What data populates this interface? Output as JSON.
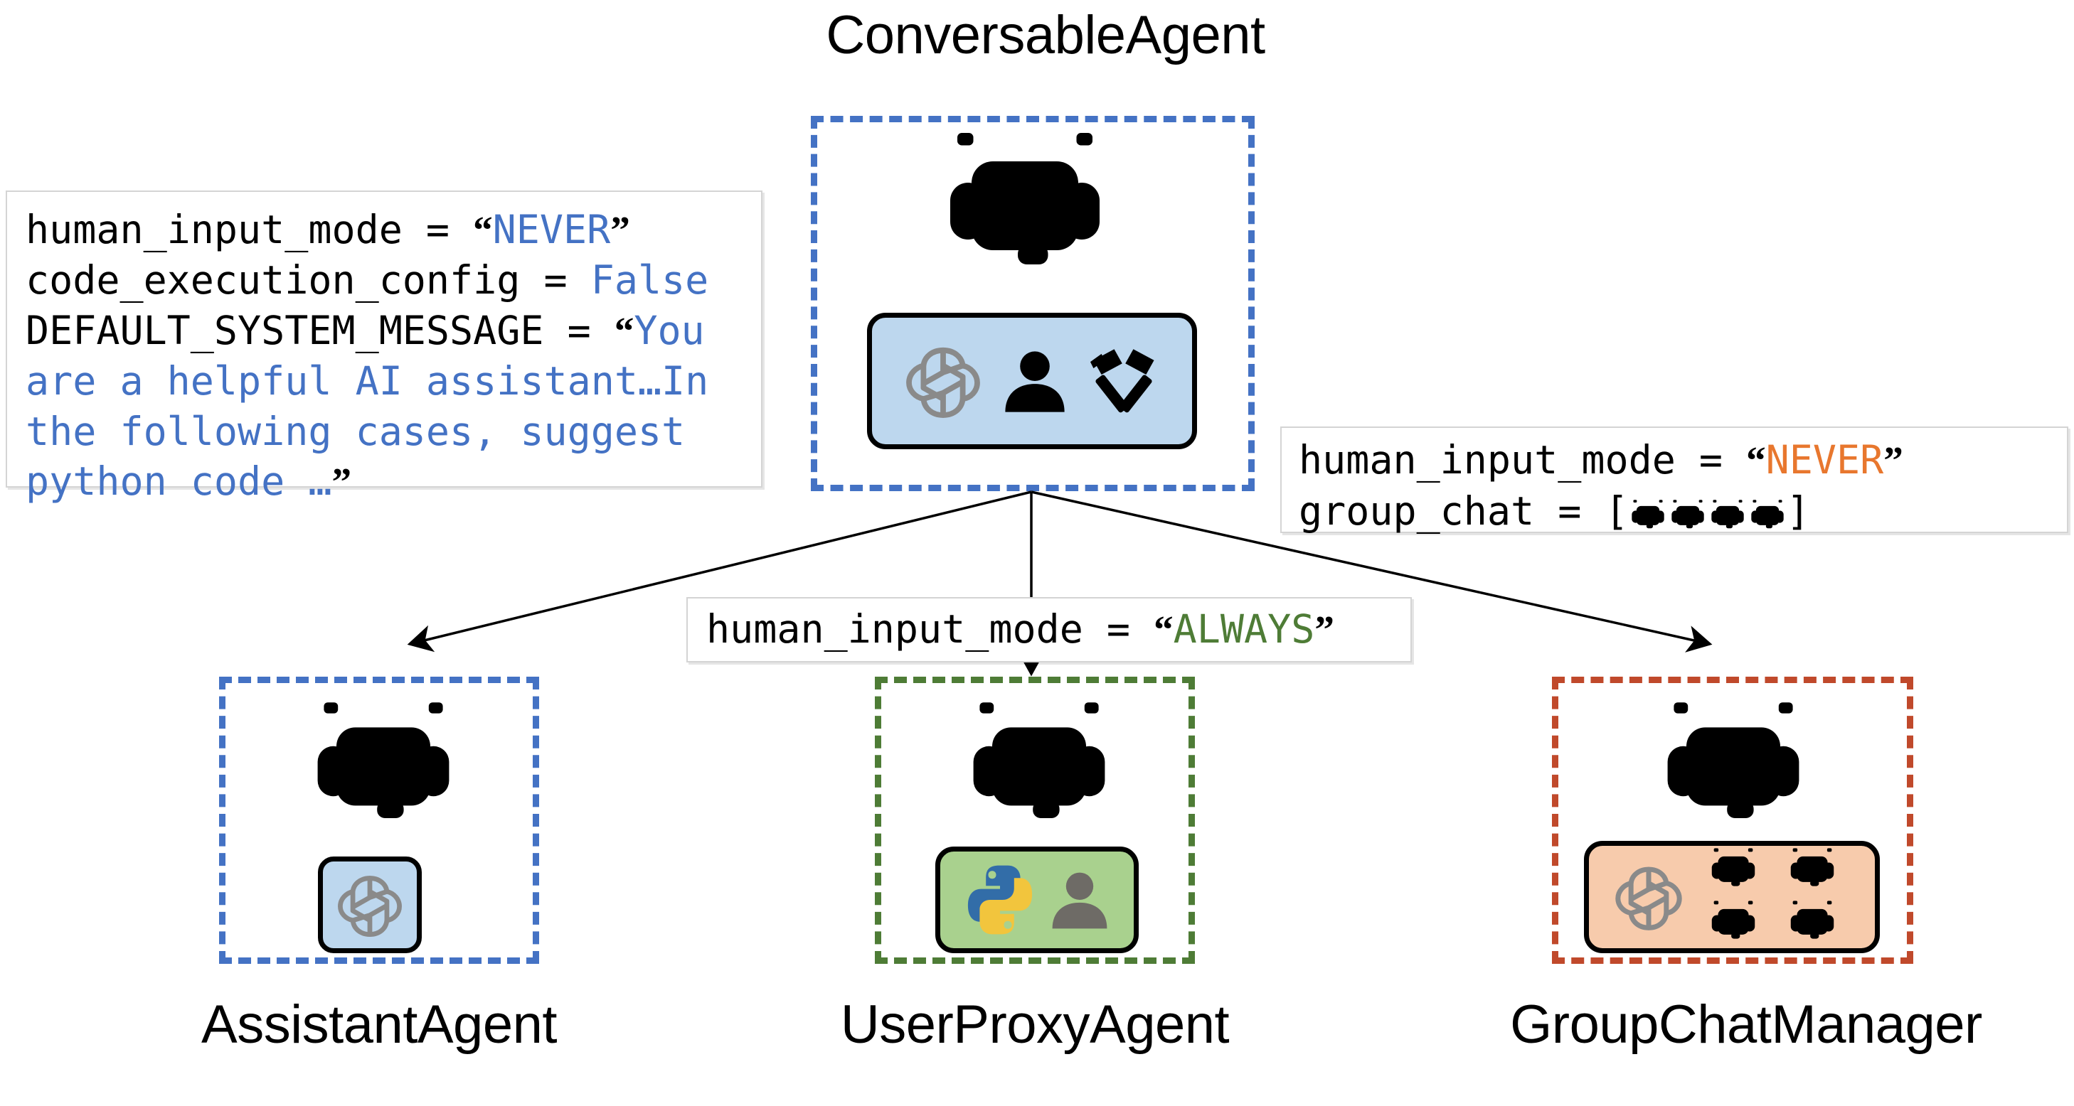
{
  "diagram": {
    "title": "ConversableAgent hierarchy",
    "root": {
      "label": "ConversableAgent",
      "frame_color": "#4472C4",
      "robot_color": "blue",
      "capabilities": [
        "openai-logo-icon",
        "person-icon",
        "tools-hammers-icon"
      ]
    },
    "children": [
      {
        "label": "AssistantAgent",
        "frame_color": "#4472C4",
        "robot_color": "blue",
        "capabilities": [
          "openai-logo-icon"
        ]
      },
      {
        "label": "UserProxyAgent",
        "frame_color": "#4E7C36",
        "robot_color": "green",
        "capabilities": [
          "python-logo-icon",
          "person-icon"
        ]
      },
      {
        "label": "GroupChatManager",
        "frame_color": "#C0492B",
        "robot_color": "brown",
        "capabilities": [
          "openai-logo-icon",
          "robot-grid-icon"
        ]
      }
    ]
  },
  "annotations": {
    "assistant_config": {
      "lines": [
        {
          "key": "human_input_mode",
          "op": " = ",
          "quoted": true,
          "value": "NEVER",
          "value_color": "#4472C4"
        },
        {
          "key": "code_execution_config",
          "op": " = ",
          "quoted": false,
          "value": "False",
          "value_color": "#4472C4"
        },
        {
          "key": "DEFAULT_SYSTEM_MESSAGE",
          "op": " = ",
          "quoted": true,
          "value": "You are a helpful AI assistant…In the following cases, suggest python code …",
          "value_color": "#4472C4"
        }
      ],
      "line1_key": "human_input_mode = ",
      "line1_value": "NEVER",
      "line2_key": "code_execution_config = ",
      "line2_value": "False",
      "line3_key": "DEFAULT_SYSTEM_MESSAGE = ",
      "line3_value": "You are a helpful AI assistant…In the following cases, suggest python code …"
    },
    "groupchat_config": {
      "line1_key": "human_input_mode = ",
      "line1_value": "NEVER",
      "line2_key": "group_chat = ",
      "bracket_open": "[",
      "bracket_close": "]",
      "members": [
        "blue",
        "green",
        "blue",
        "green"
      ]
    },
    "userproxy_config": {
      "line1_key": "human_input_mode = ",
      "line1_value": "ALWAYS"
    }
  },
  "colors": {
    "blue_frame": "#4472C4",
    "green_frame": "#4E7C36",
    "red_frame": "#C0492B",
    "capsule_blue": "#BDD7EE",
    "capsule_green": "#A9D18E",
    "capsule_orange": "#F7CBAC",
    "value_blue": "#4472C4",
    "value_orange": "#E8772E",
    "value_green": "#4E7C36",
    "robot_blue": "#6AAEE8",
    "robot_green": "#78A45E",
    "robot_brown": "#A06C45",
    "openai_gray": "#8A8A8A"
  }
}
